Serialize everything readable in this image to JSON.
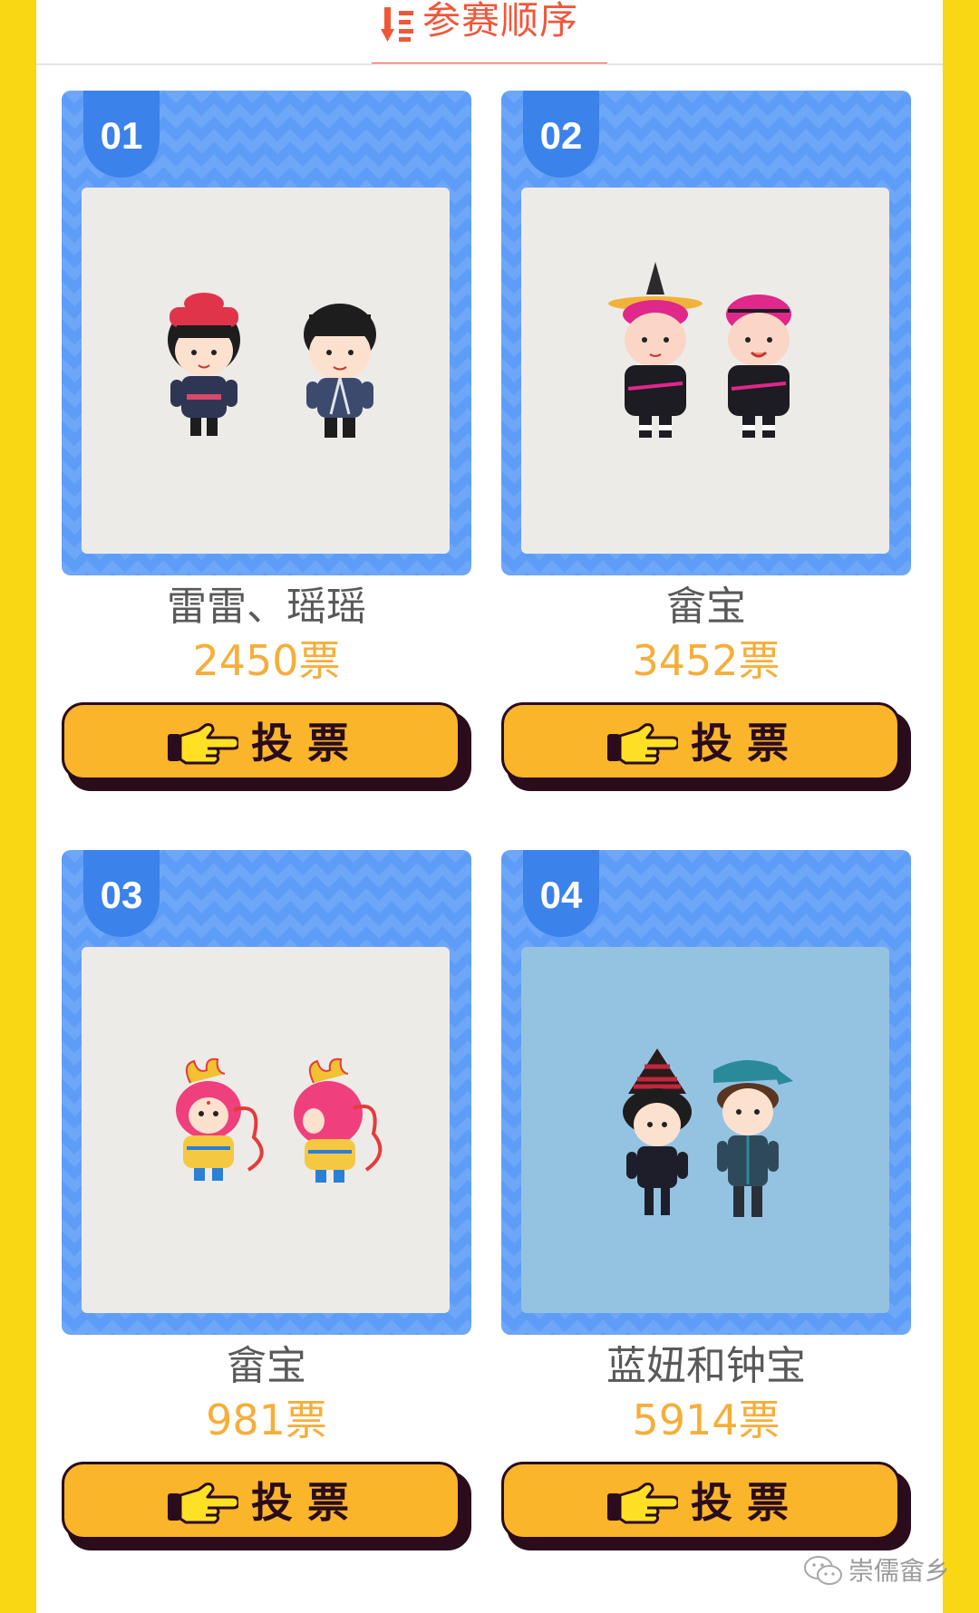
{
  "header": {
    "title": "参赛顺序",
    "icon": "sort-descending-icon",
    "accent_color": "#f0573a"
  },
  "theme": {
    "outer_background": "#fad713",
    "card_frame_color": "#5e9df7",
    "badge_color": "#3b82ea",
    "vote_count_color": "#f6ae3a",
    "vote_button_color": "#fbb52a"
  },
  "entries": [
    {
      "number": "01",
      "name": "雷雷、瑶瑶",
      "votes": "2450票",
      "vote_label": "投票",
      "image": "mascot-pair-1"
    },
    {
      "number": "02",
      "name": "畲宝",
      "votes": "3452票",
      "vote_label": "投票",
      "image": "mascot-pair-2"
    },
    {
      "number": "03",
      "name": "畲宝",
      "votes": "981票",
      "vote_label": "投票",
      "image": "mascot-pair-3"
    },
    {
      "number": "04",
      "name": "蓝妞和钟宝",
      "votes": "5914票",
      "vote_label": "投票",
      "image": "mascot-pair-4"
    }
  ],
  "watermark": {
    "text": "崇儒畲乡",
    "icon": "wechat-icon"
  }
}
